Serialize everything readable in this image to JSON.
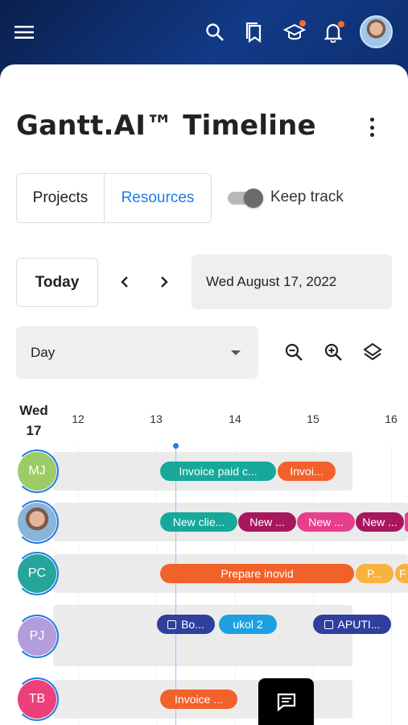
{
  "app": {
    "title": "Gantt.AI™ Timeline"
  },
  "tabs": {
    "projects": "Projects",
    "resources": "Resources"
  },
  "toggle": {
    "label": "Keep track"
  },
  "nav": {
    "today": "Today",
    "date": "Wed August 17, 2022"
  },
  "view": {
    "selected": "Day"
  },
  "timeline": {
    "day_name": "Wed",
    "day_num": "17",
    "ticks": [
      "12",
      "13",
      "14",
      "15",
      "16"
    ]
  },
  "resources": [
    {
      "initials": "MJ",
      "color": "#9ccc65"
    },
    {
      "initials": "",
      "color": "#8ab4d8"
    },
    {
      "initials": "PC",
      "color": "#26a69a"
    },
    {
      "initials": "PJ",
      "color": "#b39ddb"
    },
    {
      "initials": "TB",
      "color": "#ec407a"
    }
  ],
  "tasks": {
    "r1": [
      {
        "label": "Invoice paid c...",
        "color": "#16a89b"
      },
      {
        "label": "Invoi...",
        "color": "#f2612a"
      }
    ],
    "r2": [
      {
        "label": "New clie...",
        "color": "#16a89b"
      },
      {
        "label": "New ...",
        "color": "#a8175e"
      },
      {
        "label": "New ...",
        "color": "#e83e8c"
      },
      {
        "label": "New ...",
        "color": "#a8175e"
      }
    ],
    "r3": [
      {
        "label": "Prepare inovid",
        "color": "#f2612a"
      },
      {
        "label": "P...",
        "color": "#f9b23c"
      },
      {
        "label": "F",
        "color": "#f9b23c"
      }
    ],
    "r4": [
      {
        "label": "Bo...",
        "color": "#2f3f9e"
      },
      {
        "label": "ukol 2",
        "color": "#1ea0e0"
      },
      {
        "label": "APUTI...",
        "color": "#2f3f9e"
      }
    ],
    "r5": [
      {
        "label": "Invoice ...",
        "color": "#f2612a"
      }
    ]
  },
  "icons": {
    "menu": "menu-icon",
    "search": "search-icon",
    "bookmarks": "bookmarks-icon",
    "academy": "graduation-cap-icon",
    "notifications": "bell-icon",
    "more": "more-vertical-icon",
    "zoom_out": "zoom-out-icon",
    "zoom_in": "zoom-in-icon",
    "layers": "layers-icon",
    "chat": "chat-icon"
  }
}
